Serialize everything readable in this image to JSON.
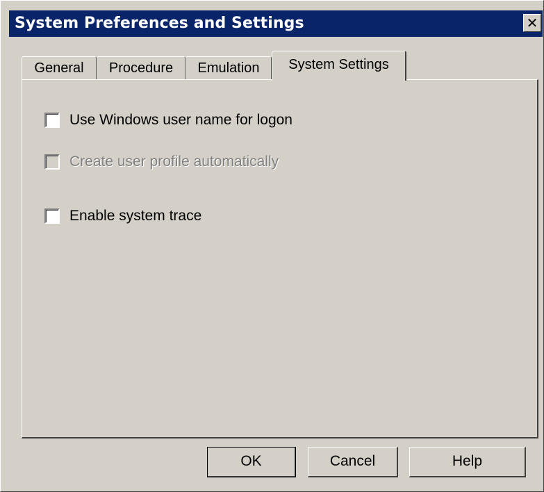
{
  "window": {
    "title": "System Preferences and Settings",
    "close_glyph": "✕"
  },
  "tabs": [
    {
      "label": "General",
      "active": false
    },
    {
      "label": "Procedure",
      "active": false
    },
    {
      "label": "Emulation",
      "active": false
    },
    {
      "label": "System Settings",
      "active": true
    }
  ],
  "options": [
    {
      "label": "Use Windows user name for logon",
      "checked": false,
      "enabled": true
    },
    {
      "label": "Create user profile automatically",
      "checked": false,
      "enabled": false
    },
    {
      "label": "Enable system trace",
      "checked": false,
      "enabled": true
    }
  ],
  "buttons": {
    "ok": "OK",
    "cancel": "Cancel",
    "help": "Help"
  },
  "colors": {
    "titlebar": "#0a246a",
    "face": "#d4d0c8",
    "disabled_text": "#808080"
  }
}
